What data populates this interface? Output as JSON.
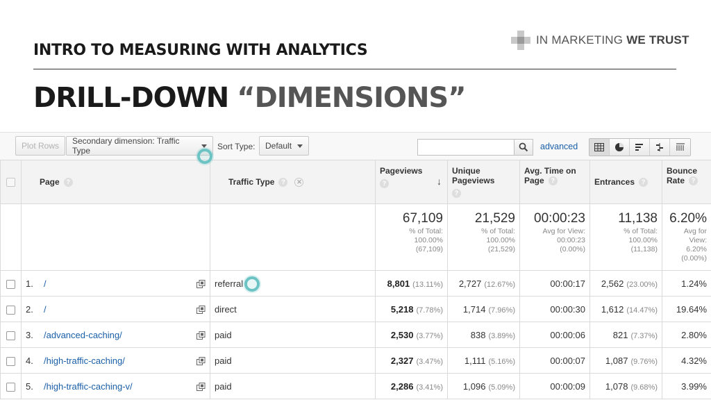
{
  "slide": {
    "subtitle": "INTRO TO MEASURING WITH ANALYTICS",
    "title": "DRILL-DOWN",
    "title_accent": "“DIMENSIONS”",
    "brand_light": "IN MARKETING",
    "brand_bold": "WE TRUST"
  },
  "toolbar": {
    "plot_rows": "Plot Rows",
    "secondary_dimension": "Secondary dimension: Traffic Type",
    "sort_type_label": "Sort Type:",
    "sort_type_value": "Default",
    "search_value": "",
    "advanced": "advanced"
  },
  "table": {
    "headers": {
      "page": "Page",
      "traffic_type": "Traffic Type",
      "pageviews": "Pageviews",
      "unique_pageviews_1": "Unique",
      "unique_pageviews_2": "Pageviews",
      "avg_time_1": "Avg. Time on",
      "avg_time_2": "Page",
      "entrances": "Entrances",
      "bounce_rate_1": "Bounce",
      "bounce_rate_2": "Rate"
    },
    "totals": {
      "pageviews": {
        "value": "67,109",
        "l1": "% of Total:",
        "l2": "100.00%",
        "l3": "(67,109)"
      },
      "unique": {
        "value": "21,529",
        "l1": "% of Total:",
        "l2": "100.00%",
        "l3": "(21,529)"
      },
      "avg_time": {
        "value": "00:00:23",
        "l1": "Avg for View:",
        "l2": "00:00:23",
        "l3": "(0.00%)"
      },
      "entrances": {
        "value": "11,138",
        "l1": "% of Total:",
        "l2": "100.00%",
        "l3": "(11,138)"
      },
      "bounce": {
        "value": "6.20%",
        "l1": "Avg for",
        "l2": "View:",
        "l3": "6.20%",
        "l4": "(0.00%)"
      }
    },
    "rows": [
      {
        "num": "1.",
        "page": "/",
        "traffic": "referral",
        "pv": "8,801",
        "pv_pct": "(13.11%)",
        "upv": "2,727",
        "upv_pct": "(12.67%)",
        "time": "00:00:17",
        "ent": "2,562",
        "ent_pct": "(23.00%)",
        "bounce": "1.24%"
      },
      {
        "num": "2.",
        "page": "/",
        "traffic": "direct",
        "pv": "5,218",
        "pv_pct": "(7.78%)",
        "upv": "1,714",
        "upv_pct": "(7.96%)",
        "time": "00:00:30",
        "ent": "1,612",
        "ent_pct": "(14.47%)",
        "bounce": "19.64%"
      },
      {
        "num": "3.",
        "page": "/advanced-caching/",
        "traffic": "paid",
        "pv": "2,530",
        "pv_pct": "(3.77%)",
        "upv": "838",
        "upv_pct": "(3.89%)",
        "time": "00:00:06",
        "ent": "821",
        "ent_pct": "(7.37%)",
        "bounce": "2.80%"
      },
      {
        "num": "4.",
        "page": "/high-traffic-caching/",
        "traffic": "paid",
        "pv": "2,327",
        "pv_pct": "(3.47%)",
        "upv": "1,111",
        "upv_pct": "(5.16%)",
        "time": "00:00:07",
        "ent": "1,087",
        "ent_pct": "(9.76%)",
        "bounce": "4.32%"
      },
      {
        "num": "5.",
        "page": "/high-traffic-caching-v/",
        "traffic": "paid",
        "pv": "2,286",
        "pv_pct": "(3.41%)",
        "upv": "1,096",
        "upv_pct": "(5.09%)",
        "time": "00:00:09",
        "ent": "1,078",
        "ent_pct": "(9.68%)",
        "bounce": "3.99%"
      }
    ]
  },
  "colors": {
    "link": "#1a5fa8",
    "highlight_ring": "#6cc3c4"
  }
}
